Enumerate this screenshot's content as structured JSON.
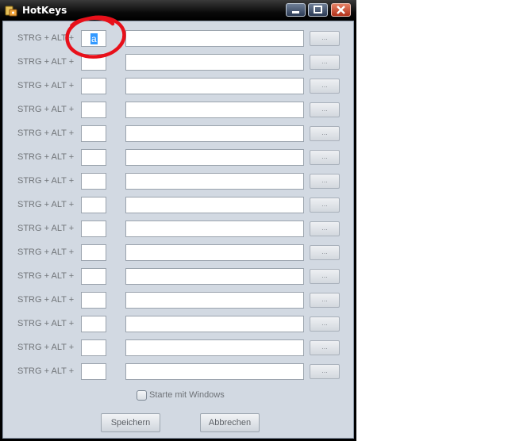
{
  "window": {
    "title": "HotKeys",
    "icon": "app-icon"
  },
  "hotkey_prefix": "STRG + ALT +",
  "rows": [
    {
      "label": "STRG + ALT +",
      "key": "a",
      "path": "",
      "browse": "..."
    },
    {
      "label": "STRG + ALT +",
      "key": "",
      "path": "",
      "browse": "..."
    },
    {
      "label": "STRG + ALT +",
      "key": "",
      "path": "",
      "browse": "..."
    },
    {
      "label": "STRG + ALT +",
      "key": "",
      "path": "",
      "browse": "..."
    },
    {
      "label": "STRG + ALT +",
      "key": "",
      "path": "",
      "browse": "..."
    },
    {
      "label": "STRG + ALT +",
      "key": "",
      "path": "",
      "browse": "..."
    },
    {
      "label": "STRG + ALT +",
      "key": "",
      "path": "",
      "browse": "..."
    },
    {
      "label": "STRG + ALT +",
      "key": "",
      "path": "",
      "browse": "..."
    },
    {
      "label": "STRG + ALT +",
      "key": "",
      "path": "",
      "browse": "..."
    },
    {
      "label": "STRG + ALT +",
      "key": "",
      "path": "",
      "browse": "..."
    },
    {
      "label": "STRG + ALT +",
      "key": "",
      "path": "",
      "browse": "..."
    },
    {
      "label": "STRG + ALT +",
      "key": "",
      "path": "",
      "browse": "..."
    },
    {
      "label": "STRG + ALT +",
      "key": "",
      "path": "",
      "browse": "..."
    },
    {
      "label": "STRG + ALT +",
      "key": "",
      "path": "",
      "browse": "..."
    },
    {
      "label": "STRG + ALT +",
      "key": "",
      "path": "",
      "browse": "..."
    }
  ],
  "startup_checkbox": {
    "label": "Starte mit Windows",
    "checked": false
  },
  "buttons": {
    "save": "Speichern",
    "cancel": "Abbrechen"
  },
  "colors": {
    "annotation_circle": "#e8101a",
    "selection": "#3399ff",
    "client_bg": "#d2d9e2"
  }
}
